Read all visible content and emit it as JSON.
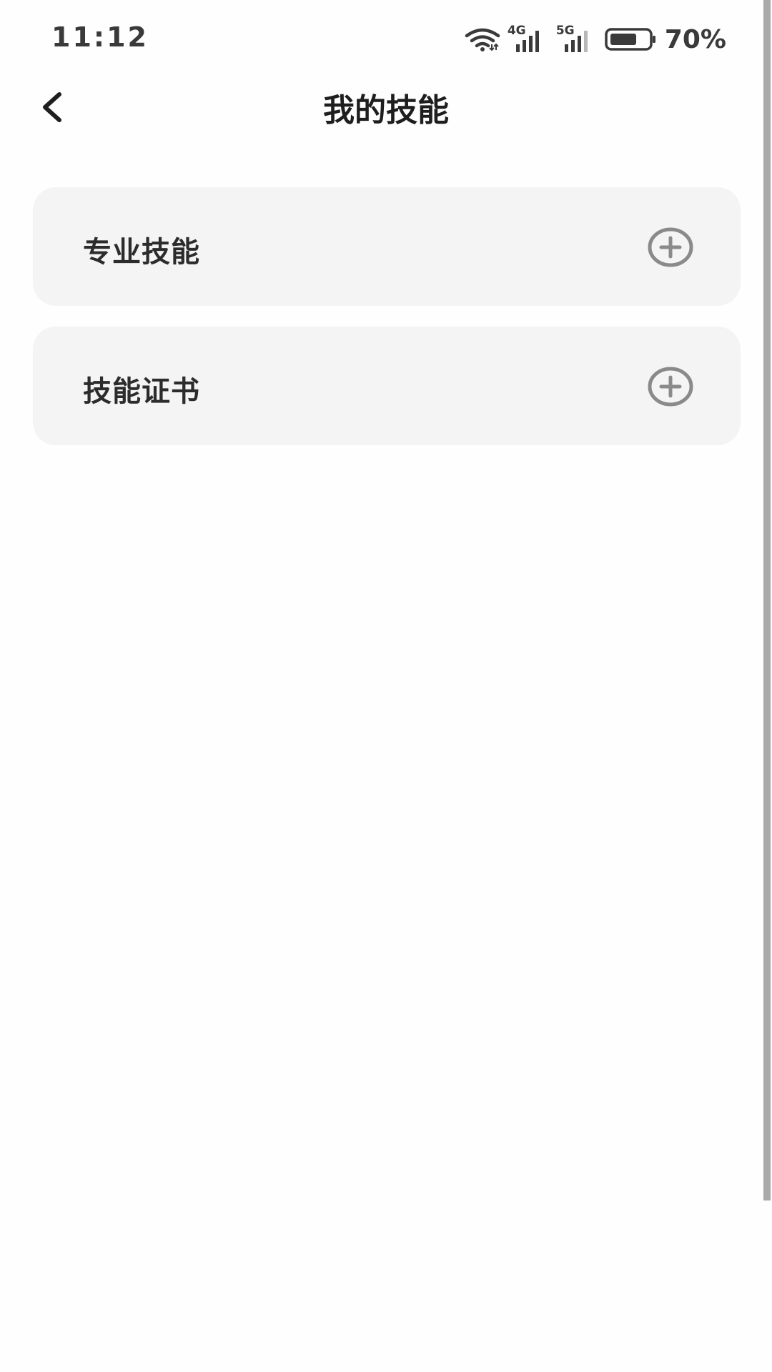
{
  "status_bar": {
    "time": "11:12",
    "battery_percent": "70%",
    "battery_level": 0.7,
    "network_1": "4G",
    "network_2": "5G",
    "icons": [
      "wifi-icon",
      "signal-4g-icon",
      "signal-5g-icon",
      "battery-icon"
    ]
  },
  "header": {
    "title": "我的技能",
    "back_icon": "back-arrow-icon"
  },
  "cards": [
    {
      "label": "专业技能",
      "icon": "add-circle-icon"
    },
    {
      "label": "技能证书",
      "icon": "add-circle-icon"
    }
  ],
  "colors": {
    "background": "#fefefe",
    "card_background": "#f4f4f4",
    "icon_gray": "#8a8a8a",
    "text_dark": "#1e1e1e"
  }
}
